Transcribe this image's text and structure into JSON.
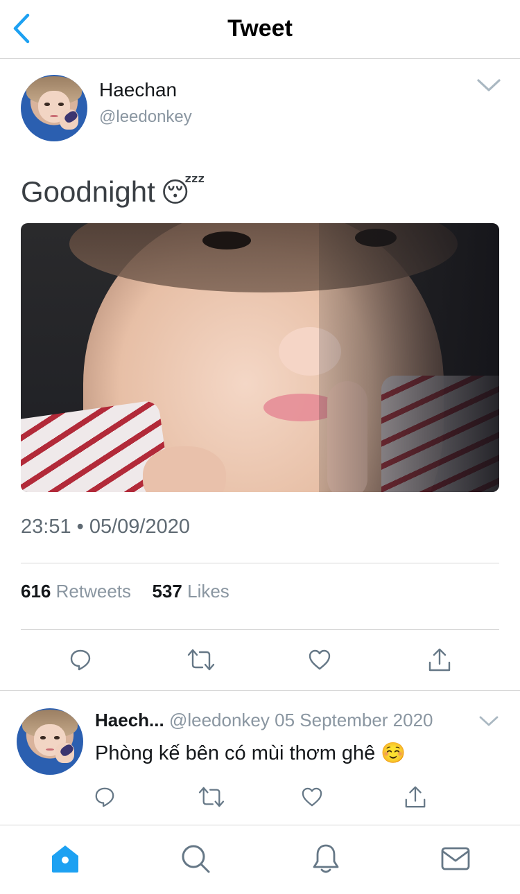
{
  "header": {
    "title": "Tweet",
    "back_icon": "chevron-left-icon",
    "accent_color": "#1da1f2"
  },
  "tweet": {
    "author_name": "Haechan",
    "author_handle": "@leedonkey",
    "text": "Goodnight",
    "emoji": "😴",
    "timestamp": "23:51 • 05/09/2020",
    "retweets_count": "616",
    "retweets_label": "Retweets",
    "likes_count": "537",
    "likes_label": "Likes",
    "media_description_icon": "photo",
    "actions": [
      "reply-icon",
      "retweet-icon",
      "like-icon",
      "share-icon"
    ]
  },
  "reply": {
    "author_name": "Haech...",
    "author_handle": "@leedonkey",
    "date": "05 September 2020",
    "text": "Phòng kế bên có mùi thơm ghê",
    "emoji": "☺️",
    "actions": [
      "reply-icon",
      "retweet-icon",
      "like-icon",
      "share-icon"
    ]
  },
  "tabbar": {
    "items": [
      "home-icon",
      "search-icon",
      "notifications-icon",
      "messages-icon"
    ],
    "active": "home-icon"
  },
  "colors": {
    "text_primary": "#14171a",
    "text_secondary": "#8a96a1",
    "icon_gray": "#657786",
    "accent": "#1da1f2",
    "divider": "#d6d6d6"
  }
}
